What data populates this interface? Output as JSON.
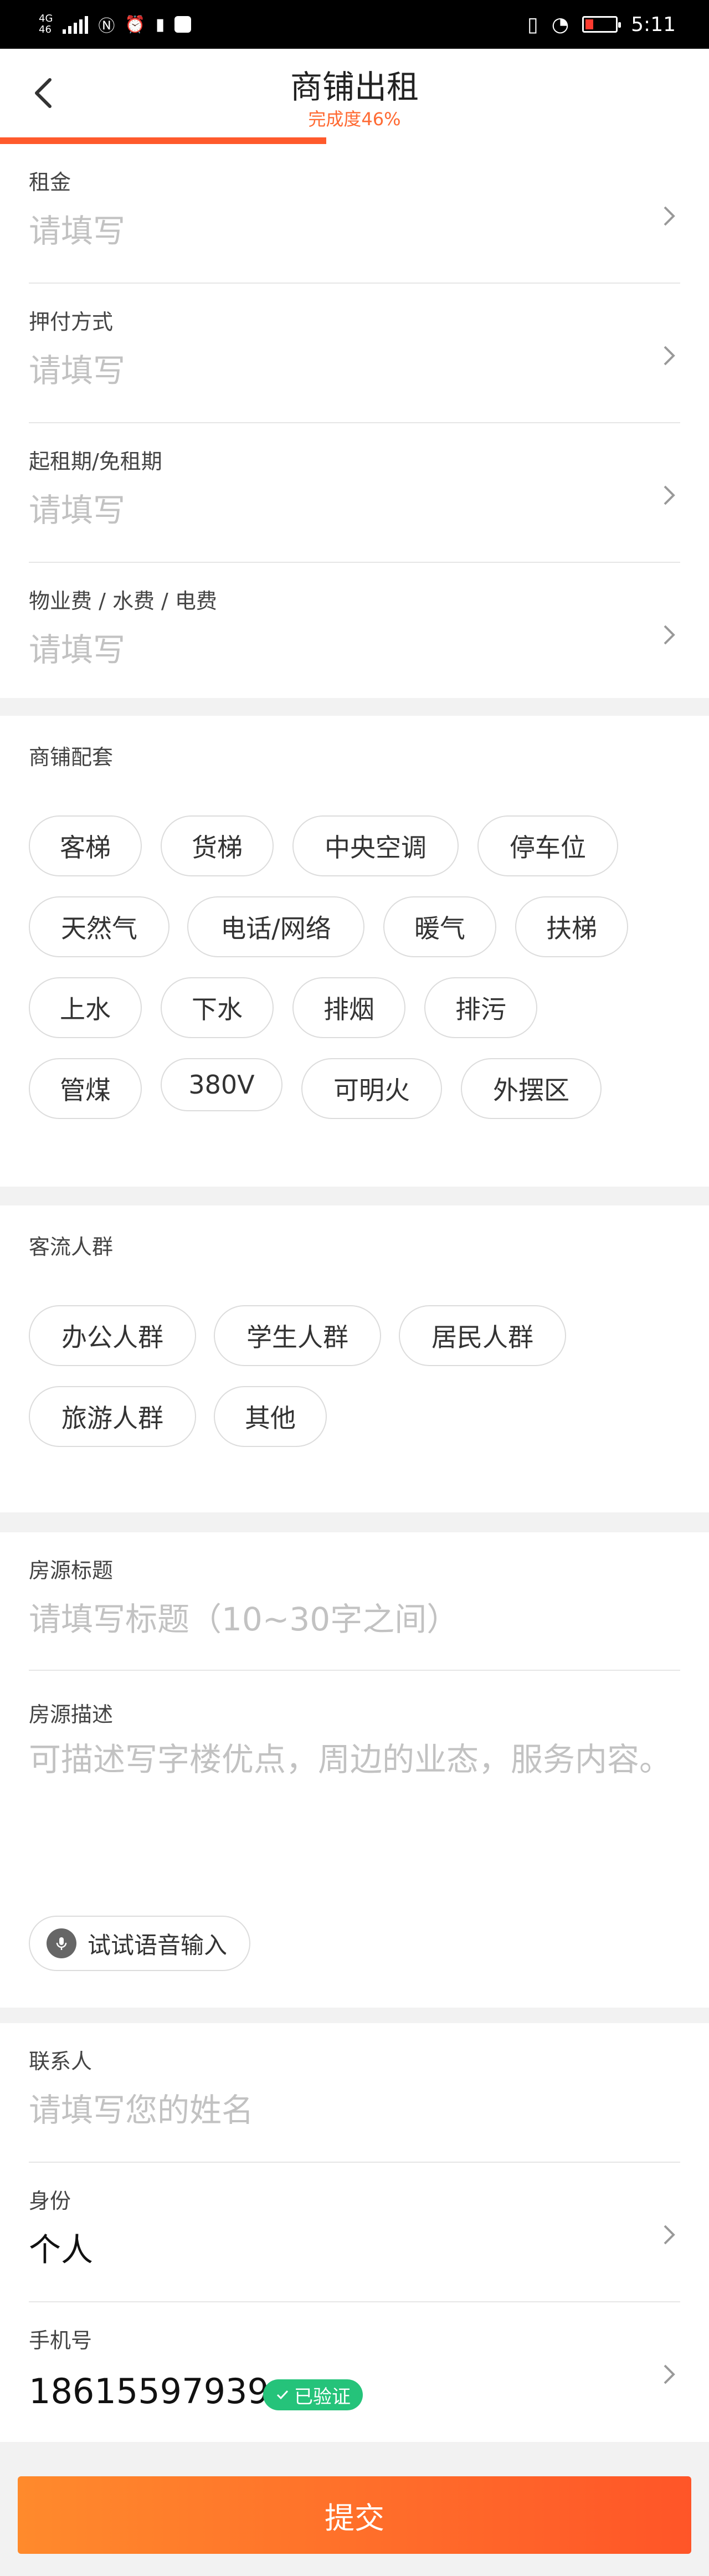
{
  "status_bar": {
    "network_top": "4G",
    "network_bottom": "46",
    "time": "5:11"
  },
  "header": {
    "title": "商铺出租",
    "subtitle": "完成度46%",
    "progress_fraction": 0.46
  },
  "fields_top": [
    {
      "label": "租金",
      "placeholder": "请填写"
    },
    {
      "label": "押付方式",
      "placeholder": "请填写"
    },
    {
      "label": "起租期/免租期",
      "placeholder": "请填写"
    },
    {
      "label": "物业费 / 水费 / 电费",
      "placeholder": "请填写"
    }
  ],
  "amenities": {
    "title": "商铺配套",
    "options": [
      "客梯",
      "货梯",
      "中央空调",
      "停车位",
      "天然气",
      "电话/网络",
      "暖气",
      "扶梯",
      "上水",
      "下水",
      "排烟",
      "排污",
      "管煤",
      "380V",
      "可明火",
      "外摆区"
    ]
  },
  "customers": {
    "title": "客流人群",
    "options": [
      "办公人群",
      "学生人群",
      "居民人群",
      "旅游人群",
      "其他"
    ]
  },
  "listing": {
    "title_label": "房源标题",
    "title_placeholder": "请填写标题（10~30字之间）",
    "desc_label": "房源描述",
    "desc_placeholder": "可描述写字楼优点，周边的业态，服务内容。",
    "voice_label": "试试语音输入"
  },
  "contact": {
    "name_label": "联系人",
    "name_placeholder": "请填写您的姓名",
    "identity_label": "身份",
    "identity_value": "个人",
    "phone_label": "手机号",
    "phone_value": "18615597939",
    "verified_label": "已验证"
  },
  "submit_label": "提交",
  "colors": {
    "accent": "#ff5a2c",
    "verified": "#25c37a",
    "placeholder": "#c2c2c2"
  }
}
